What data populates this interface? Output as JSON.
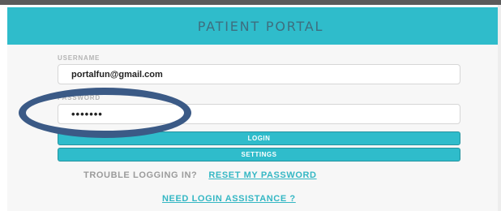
{
  "header": {
    "title": "PATIENT PORTAL"
  },
  "login_form": {
    "username_label": "USERNAME",
    "username_value": "portalfun@gmail.com",
    "password_label": "PASSWORD",
    "password_value": "•••••••",
    "login_button": "LOGIN",
    "settings_button": "SETTINGS"
  },
  "help": {
    "trouble_text": "TROUBLE LOGGING IN?",
    "reset_link": "RESET MY PASSWORD",
    "assistance_link": "NEED LOGIN ASSISTANCE ?"
  },
  "annotation": {
    "shape": "ellipse",
    "color": "#3b5a86"
  },
  "colors": {
    "brand": "#2fbccb",
    "header_text": "#3e6e7f",
    "link": "#34b7c4"
  }
}
